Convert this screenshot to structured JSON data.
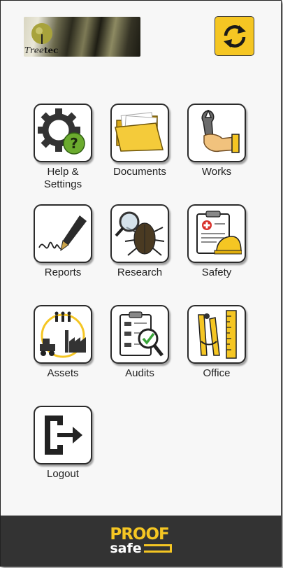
{
  "header": {
    "logo_text_prefix": "Tree",
    "logo_text_suffix": "tec"
  },
  "tiles": [
    {
      "label": "Help &\nSettings",
      "icon": "gear-question-icon"
    },
    {
      "label": "Documents",
      "icon": "folder-icon"
    },
    {
      "label": "Works",
      "icon": "wrench-hand-icon"
    },
    {
      "label": "Reports",
      "icon": "pen-signature-icon"
    },
    {
      "label": "Research",
      "icon": "beetle-magnifier-icon"
    },
    {
      "label": "Safety",
      "icon": "clipboard-hardhat-icon"
    },
    {
      "label": "Assets",
      "icon": "factory-vehicles-icon"
    },
    {
      "label": "Audits",
      "icon": "checklist-magnifier-icon"
    },
    {
      "label": "Office",
      "icon": "ruler-compass-icon"
    },
    {
      "label": "Logout",
      "icon": "logout-door-icon"
    }
  ],
  "footer": {
    "brand_top": "PROOF",
    "brand_bottom": "safe"
  },
  "colors": {
    "accent": "#f5c623",
    "footer_bg": "#333333",
    "tile_border": "#2b2b2b"
  }
}
